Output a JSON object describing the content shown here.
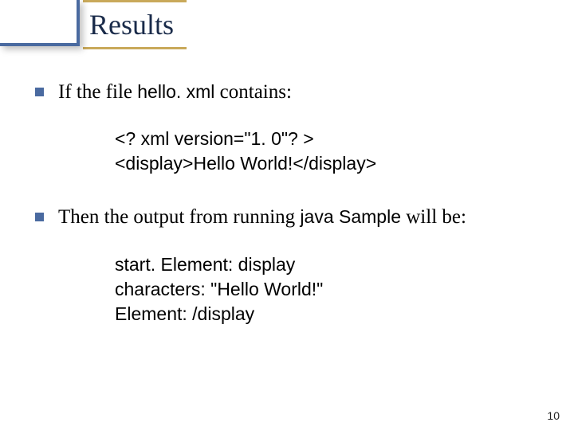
{
  "title": "Results",
  "line1": {
    "prefix": "If the file ",
    "code": "hello. xml",
    "suffix": " contains:"
  },
  "xml": {
    "l1": "<? xml version=\"1. 0\"? >",
    "l2": "<display>Hello World!</display>"
  },
  "line2": {
    "prefix": "Then the output from running ",
    "code": "java Sample",
    "suffix": " will be:"
  },
  "output": {
    "l1": "start. Element: display",
    "l2": "characters: \"Hello World!\"",
    "l3": "Element: /display"
  },
  "page": "10"
}
